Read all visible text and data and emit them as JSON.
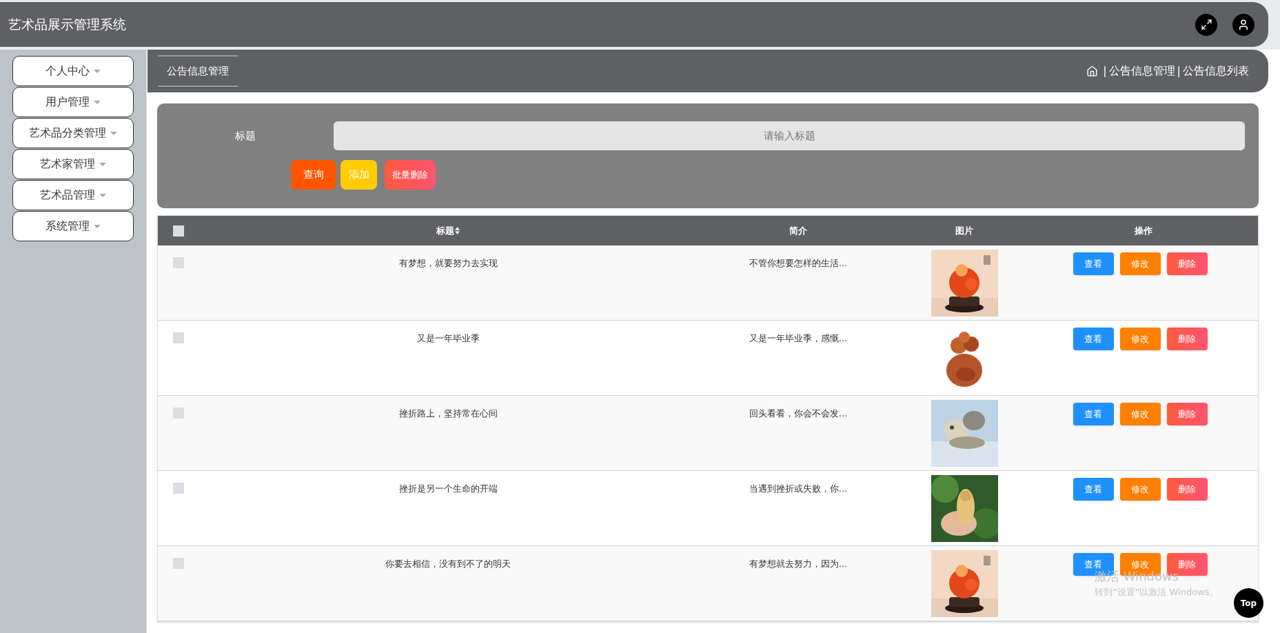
{
  "header": {
    "title": "艺术品展示管理系统"
  },
  "sidebar": {
    "items": [
      {
        "label": "个人中心"
      },
      {
        "label": "用户管理"
      },
      {
        "label": "艺术品分类管理"
      },
      {
        "label": "艺术家管理"
      },
      {
        "label": "艺术品管理"
      },
      {
        "label": "系统管理"
      }
    ]
  },
  "page_tab": {
    "label": "公告信息管理"
  },
  "breadcrumb": {
    "separator": "|",
    "items": [
      "公告信息管理",
      "公告信息列表"
    ]
  },
  "search": {
    "label": "标题",
    "placeholder": "请输入标题",
    "buttons": [
      {
        "label": "查询",
        "kind": "query"
      },
      {
        "label": "添加",
        "kind": "add"
      },
      {
        "label": "批量删除",
        "kind": "batch-delete"
      }
    ]
  },
  "table": {
    "select_all": {
      "checked": false
    },
    "columns": [
      "标题",
      "简介",
      "图片",
      "操作"
    ],
    "rows": [
      {
        "checked": false,
        "title": "有梦想，就要努力去实现",
        "summary": "不管你想要怎样的生活...",
        "actions": [
          "查看",
          "修改",
          "删除"
        ]
      },
      {
        "checked": false,
        "title": "又是一年毕业季",
        "summary": "又是一年毕业季，感慨...",
        "actions": [
          "查看",
          "修改",
          "删除"
        ]
      },
      {
        "checked": false,
        "title": "挫折路上，坚持常在心间",
        "summary": "回头看看，你会不会发...",
        "actions": [
          "查看",
          "修改",
          "删除"
        ]
      },
      {
        "checked": false,
        "title": "挫折是另一个生命的开端",
        "summary": "当遇到挫折或失败，你...",
        "actions": [
          "查看",
          "修改",
          "删除"
        ]
      },
      {
        "checked": false,
        "title": "你要去相信，没有到不了的明天",
        "summary": "有梦想就去努力，因为...",
        "actions": [
          "查看",
          "修改",
          "删除"
        ]
      }
    ]
  },
  "back_to_top": {
    "label": "Top"
  },
  "os_notice": {
    "title": "激活 Windows",
    "subtitle": "转到“设置”以激活 Windows。"
  }
}
